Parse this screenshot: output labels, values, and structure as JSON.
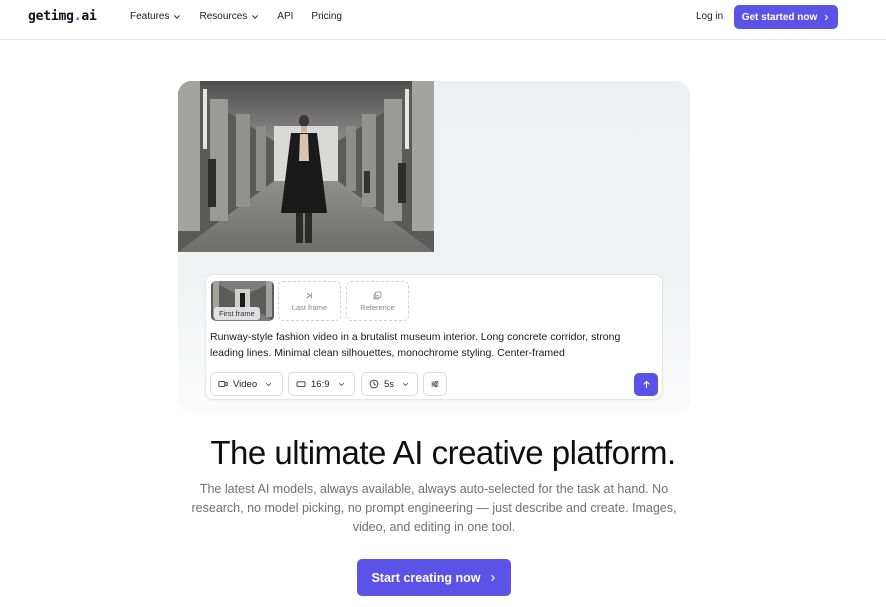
{
  "nav": {
    "logo_main": "getimg",
    "logo_dot": ".",
    "logo_suffix": "ai",
    "links": [
      {
        "label": "Features",
        "has_dropdown": true
      },
      {
        "label": "Resources",
        "has_dropdown": true
      },
      {
        "label": "API",
        "has_dropdown": false
      },
      {
        "label": "Pricing",
        "has_dropdown": false
      }
    ],
    "login_label": "Log in",
    "get_started_label": "Get started now"
  },
  "composer": {
    "first_frame_label": "First frame",
    "last_frame_label": "Last frame",
    "reference_label": "Reference",
    "prompt_text": "Runway-style fashion video in a brutalist museum interior. Long concrete corridor, strong leading lines. Minimal clean silhouettes, monochrome styling. Center-framed",
    "mode_label": "Video",
    "ratio_label": "16:9",
    "duration_label": "5s",
    "mode_icon": "video-camera-icon",
    "ratio_icon": "aspect-ratio-icon",
    "duration_icon": "clock-icon",
    "settings_icon": "sliders-icon",
    "send_icon": "arrow-up-icon"
  },
  "hero": {
    "headline": "The ultimate AI creative platform.",
    "subtext": "The latest AI models, always available, always auto-selected for the task at hand. No research, no model picking, no prompt engineering — just describe and create. Images, video, and editing in one tool.",
    "cta_label": "Start creating now"
  },
  "colors": {
    "accent": "#5b52e8",
    "text": "#111114",
    "muted": "#6f7076"
  }
}
